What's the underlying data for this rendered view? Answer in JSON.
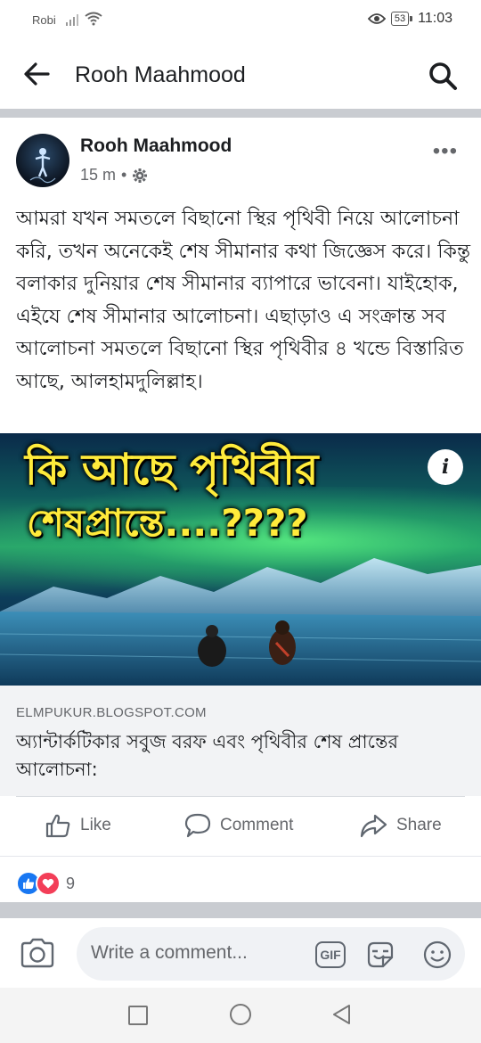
{
  "status_bar": {
    "carrier": "Robi",
    "battery": "53",
    "time": "11:03"
  },
  "app_bar": {
    "title": "Rooh Maahmood"
  },
  "post": {
    "author": "Rooh Maahmood",
    "time_ago": "15 m",
    "separator": "•",
    "text": "আমরা যখন সমতলে বিছানো স্থির পৃথিবী নিয়ে আলোচনা করি, তখন অনেকেই শেষ সীমানার কথা জিজ্ঞেস করে। কিন্তু বলাকার দুনিয়ার শেষ সীমানার ব্যাপারে ভাবেনা। যাইহোক, এইযে শেষ সীমানার আলোচনা। এছাড়াও এ সংক্রান্ত সব আলোচনা সমতলে বিছানো স্থির পৃথিবীর ৪ খন্ডে বিস্তারিত আছে, আলহামদুলিল্লাহ।",
    "image": {
      "title_line1": "কি আছে পৃথিবীর",
      "title_line2": "শেষপ্রান্তে....????",
      "info_label": "i"
    },
    "link": {
      "domain": "ELMPUKUR.BLOGSPOT.COM",
      "title": "অ্যান্টার্কটিকার সবুজ বরফ এবং পৃথিবীর শেষ প্রান্তের আলোচনা:"
    },
    "actions": {
      "like": "Like",
      "comment": "Comment",
      "share": "Share"
    },
    "reactions": {
      "count": "9"
    }
  },
  "composer": {
    "placeholder": "Write a comment...",
    "gif_label": "GIF"
  },
  "colors": {
    "like_blue": "#1877f2",
    "love_red": "#f33e58",
    "headline_yellow": "#ffeb3b"
  }
}
